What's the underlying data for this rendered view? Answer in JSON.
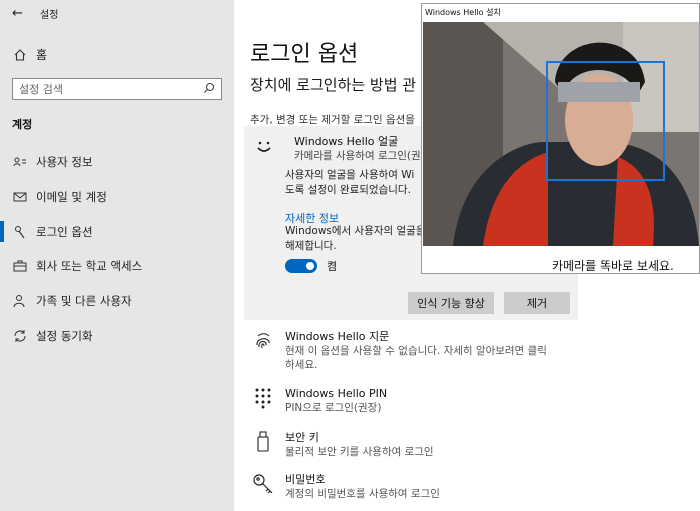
{
  "window": {
    "title": "설정"
  },
  "sidebar": {
    "home": "홈",
    "search_placeholder": "설정 검색",
    "section": "계정",
    "items": [
      {
        "label": "사용자 정보",
        "icon": "person-card-icon"
      },
      {
        "label": "이메일 및 계정",
        "icon": "mail-icon"
      },
      {
        "label": "로그인 옵션",
        "icon": "key-icon",
        "active": true
      },
      {
        "label": "회사 또는 학교 액세스",
        "icon": "briefcase-icon"
      },
      {
        "label": "가족 및 다른 사용자",
        "icon": "person-add-icon"
      },
      {
        "label": "설정 동기화",
        "icon": "sync-icon"
      }
    ]
  },
  "main": {
    "title": "로그인 옵션",
    "subtitle": "장치에 로그인하는 방법 관",
    "desc": "추가, 변경 또는 제거할 로그인 옵션을",
    "face": {
      "title": "Windows Hello 얼굴",
      "subtitle": "카메라를 사용하여 로그인(권장",
      "body_line1": "사용자의 얼굴을 사용하여 Wi",
      "body_line2": "도록 설정이 완료되었습니다.",
      "link": "자세한 정보",
      "body2_line1": "Windows에서 사용자의 얼굴을",
      "body2_line2": "해제합니다.",
      "toggle_label": "켬",
      "toggle_on": true,
      "improve_button": "인식 기능 향상",
      "remove_button": "제거"
    },
    "options": [
      {
        "title": "Windows Hello 지문",
        "lines": [
          "현재 이 옵션을 사용할 수 없습니다. 자세히 알아보려면 클릭",
          "하세요."
        ],
        "icon": "fingerprint-icon"
      },
      {
        "title": "Windows Hello PIN",
        "lines": [
          "PIN으로 로그인(권장)"
        ],
        "icon": "pin-keypad-icon"
      },
      {
        "title": "보안 키",
        "lines": [
          "물리적 보안 키를 사용하여 로그인"
        ],
        "icon": "usb-key-icon"
      },
      {
        "title": "비밀번호",
        "lines": [
          "계정의 비밀번호를 사용하여 로그인"
        ],
        "icon": "password-key-icon"
      }
    ]
  },
  "camera": {
    "title": "Windows Hello 설치",
    "caption": "카메라를 똑바로 보세요."
  },
  "colors": {
    "accent": "#0067c0",
    "sidebar_bg": "#e6e6e6",
    "panel_bg": "#f0f0f0",
    "button_bg": "#cccccc"
  }
}
